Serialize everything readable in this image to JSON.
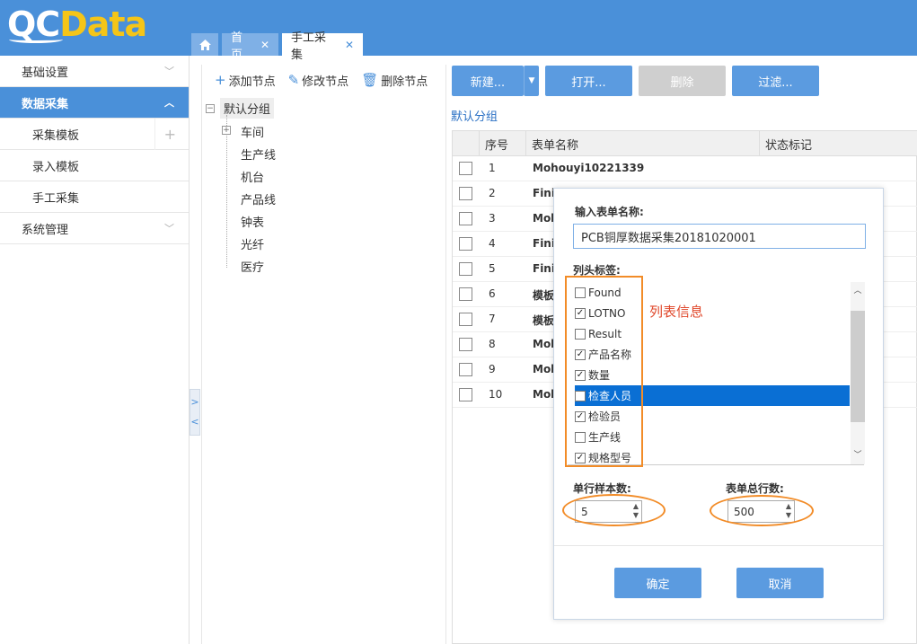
{
  "brand": {
    "logo_part1": "QC",
    "logo_part2": "Data",
    "header_color": "#4a90d9",
    "accent": "#f5c518"
  },
  "tabs": [
    {
      "label": "",
      "icon": "home-icon"
    },
    {
      "label": "首页",
      "close": "✕"
    },
    {
      "label": "手工采集",
      "close": "✕"
    }
  ],
  "sidebar": {
    "items": [
      {
        "label": "基础设置",
        "expanded": false
      },
      {
        "label": "数据采集",
        "expanded": true,
        "active": true
      },
      {
        "label": "采集模板",
        "sub": true,
        "plus": "+"
      },
      {
        "label": "录入模板",
        "sub": true
      },
      {
        "label": "手工采集",
        "sub": true
      },
      {
        "label": "系统管理",
        "expanded": false
      }
    ]
  },
  "tree_toolbar": {
    "add": "添加节点",
    "edit": "修改节点",
    "delete": "删除节点"
  },
  "tree": {
    "root": "默认分组",
    "children": [
      "车间",
      "生产线",
      "机台",
      "产品线",
      "钟表",
      "光纤",
      "医疗"
    ]
  },
  "toolbar": {
    "new": "新建...",
    "open": "打开...",
    "delete": "删除",
    "filter": "过滤..."
  },
  "breadcrumb": "默认分组",
  "grid": {
    "columns": [
      "序号",
      "表单名称",
      "状态标记"
    ],
    "rows": [
      {
        "seq": "1",
        "name": "Mohouyi10221339"
      },
      {
        "seq": "2",
        "name": "Finis"
      },
      {
        "seq": "3",
        "name": "Moh"
      },
      {
        "seq": "4",
        "name": "Finis"
      },
      {
        "seq": "5",
        "name": "Finis"
      },
      {
        "seq": "6",
        "name": "模板"
      },
      {
        "seq": "7",
        "name": "模板"
      },
      {
        "seq": "8",
        "name": "Moh"
      },
      {
        "seq": "9",
        "name": "Moh"
      },
      {
        "seq": "10",
        "name": "Moh"
      }
    ]
  },
  "dialog": {
    "name_label": "输入表单名称:",
    "name_value": "PCB铜厚数据采集20181020001",
    "columns_label": "列头标签:",
    "annotation": "列表信息",
    "columns": [
      {
        "label": "Found",
        "checked": false
      },
      {
        "label": "LOTNO",
        "checked": true
      },
      {
        "label": "Result",
        "checked": false
      },
      {
        "label": "产品名称",
        "checked": true
      },
      {
        "label": "数量",
        "checked": true
      },
      {
        "label": "检查人员",
        "checked": false,
        "selected": true
      },
      {
        "label": "检验员",
        "checked": true
      },
      {
        "label": "生产线",
        "checked": false
      },
      {
        "label": "规格型号",
        "checked": true
      }
    ],
    "samples_label": "单行样本数:",
    "samples_value": "5",
    "rows_label": "表单总行数:",
    "rows_value": "500",
    "ok": "确定",
    "cancel": "取消"
  }
}
